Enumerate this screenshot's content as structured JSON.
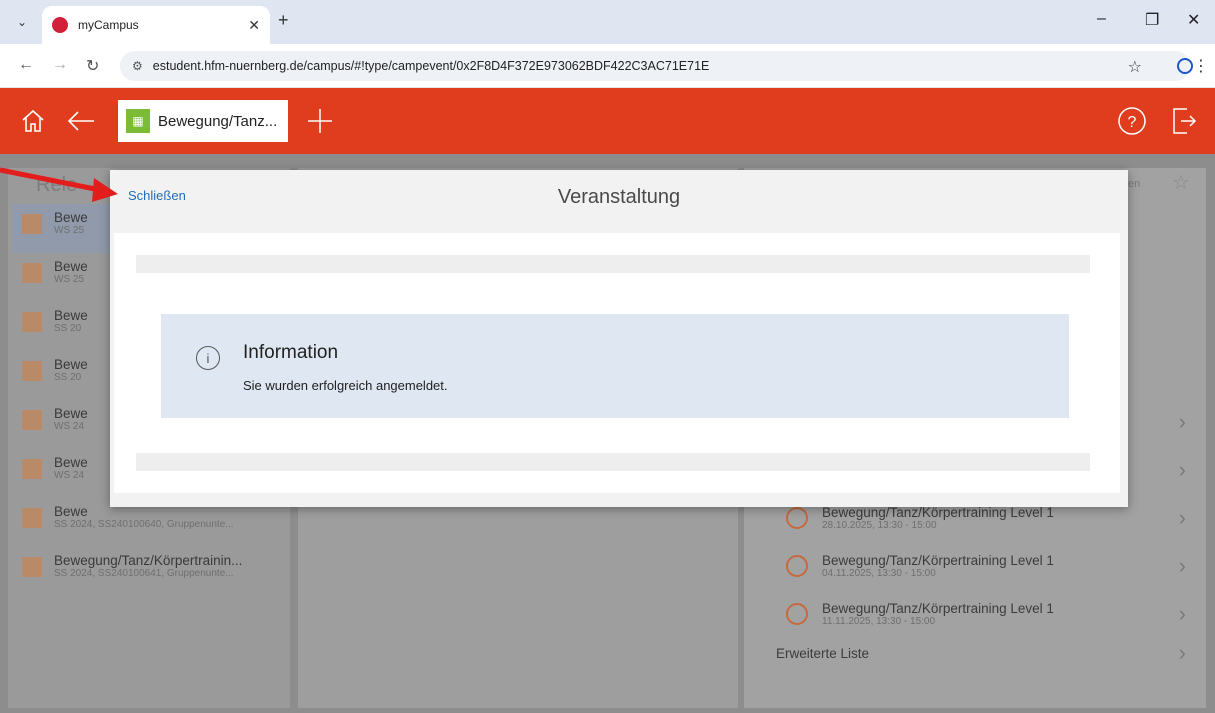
{
  "browser": {
    "tab_title": "myCampus",
    "url": "estudent.hfm-nuernberg.de/campus/#!type/campevent/0x2F8D4F372E973062BDF422C3AC71E71E",
    "win_min": "–",
    "win_max": "❐",
    "win_close": "✕"
  },
  "app": {
    "active_tab_label": "Bewegung/Tanz...",
    "accent_color": "#e03d1e"
  },
  "background": {
    "left_title": "Rele",
    "left_items": [
      {
        "title": "Bewe",
        "sub": "WS 25"
      },
      {
        "title": "Bewe",
        "sub": "WS 25"
      },
      {
        "title": "Bewe",
        "sub": "SS 20"
      },
      {
        "title": "Bewe",
        "sub": "SS 20"
      },
      {
        "title": "Bewe",
        "sub": "WS 24"
      },
      {
        "title": "Bewe",
        "sub": "WS 24"
      },
      {
        "title": "Bewe",
        "sub": "SS 2024, SS240100640, Gruppenunte..."
      },
      {
        "title": "Bewegung/Tanz/Körpertrainin...",
        "sub": "SS 2024, SS240100641, Gruppenunte..."
      }
    ],
    "right_items": [
      {
        "title": "",
        "sub": ""
      },
      {
        "title": "",
        "sub": ""
      },
      {
        "title": "Bewegung/Tanz/Körpertraining Level 1",
        "sub": "28.10.2025, 13:30 - 15:00"
      },
      {
        "title": "Bewegung/Tanz/Körpertraining Level 1",
        "sub": "04.11.2025, 13:30 - 15:00"
      },
      {
        "title": "Bewegung/Tanz/Körpertraining Level 1",
        "sub": "11.11.2025, 13:30 - 15:00"
      }
    ],
    "extended_list": "Erweiterte Liste",
    "small_right": "en"
  },
  "dialog": {
    "close_label": "Schließen",
    "title": "Veranstaltung",
    "info_title": "Information",
    "info_text": "Sie wurden erfolgreich angemeldet."
  }
}
